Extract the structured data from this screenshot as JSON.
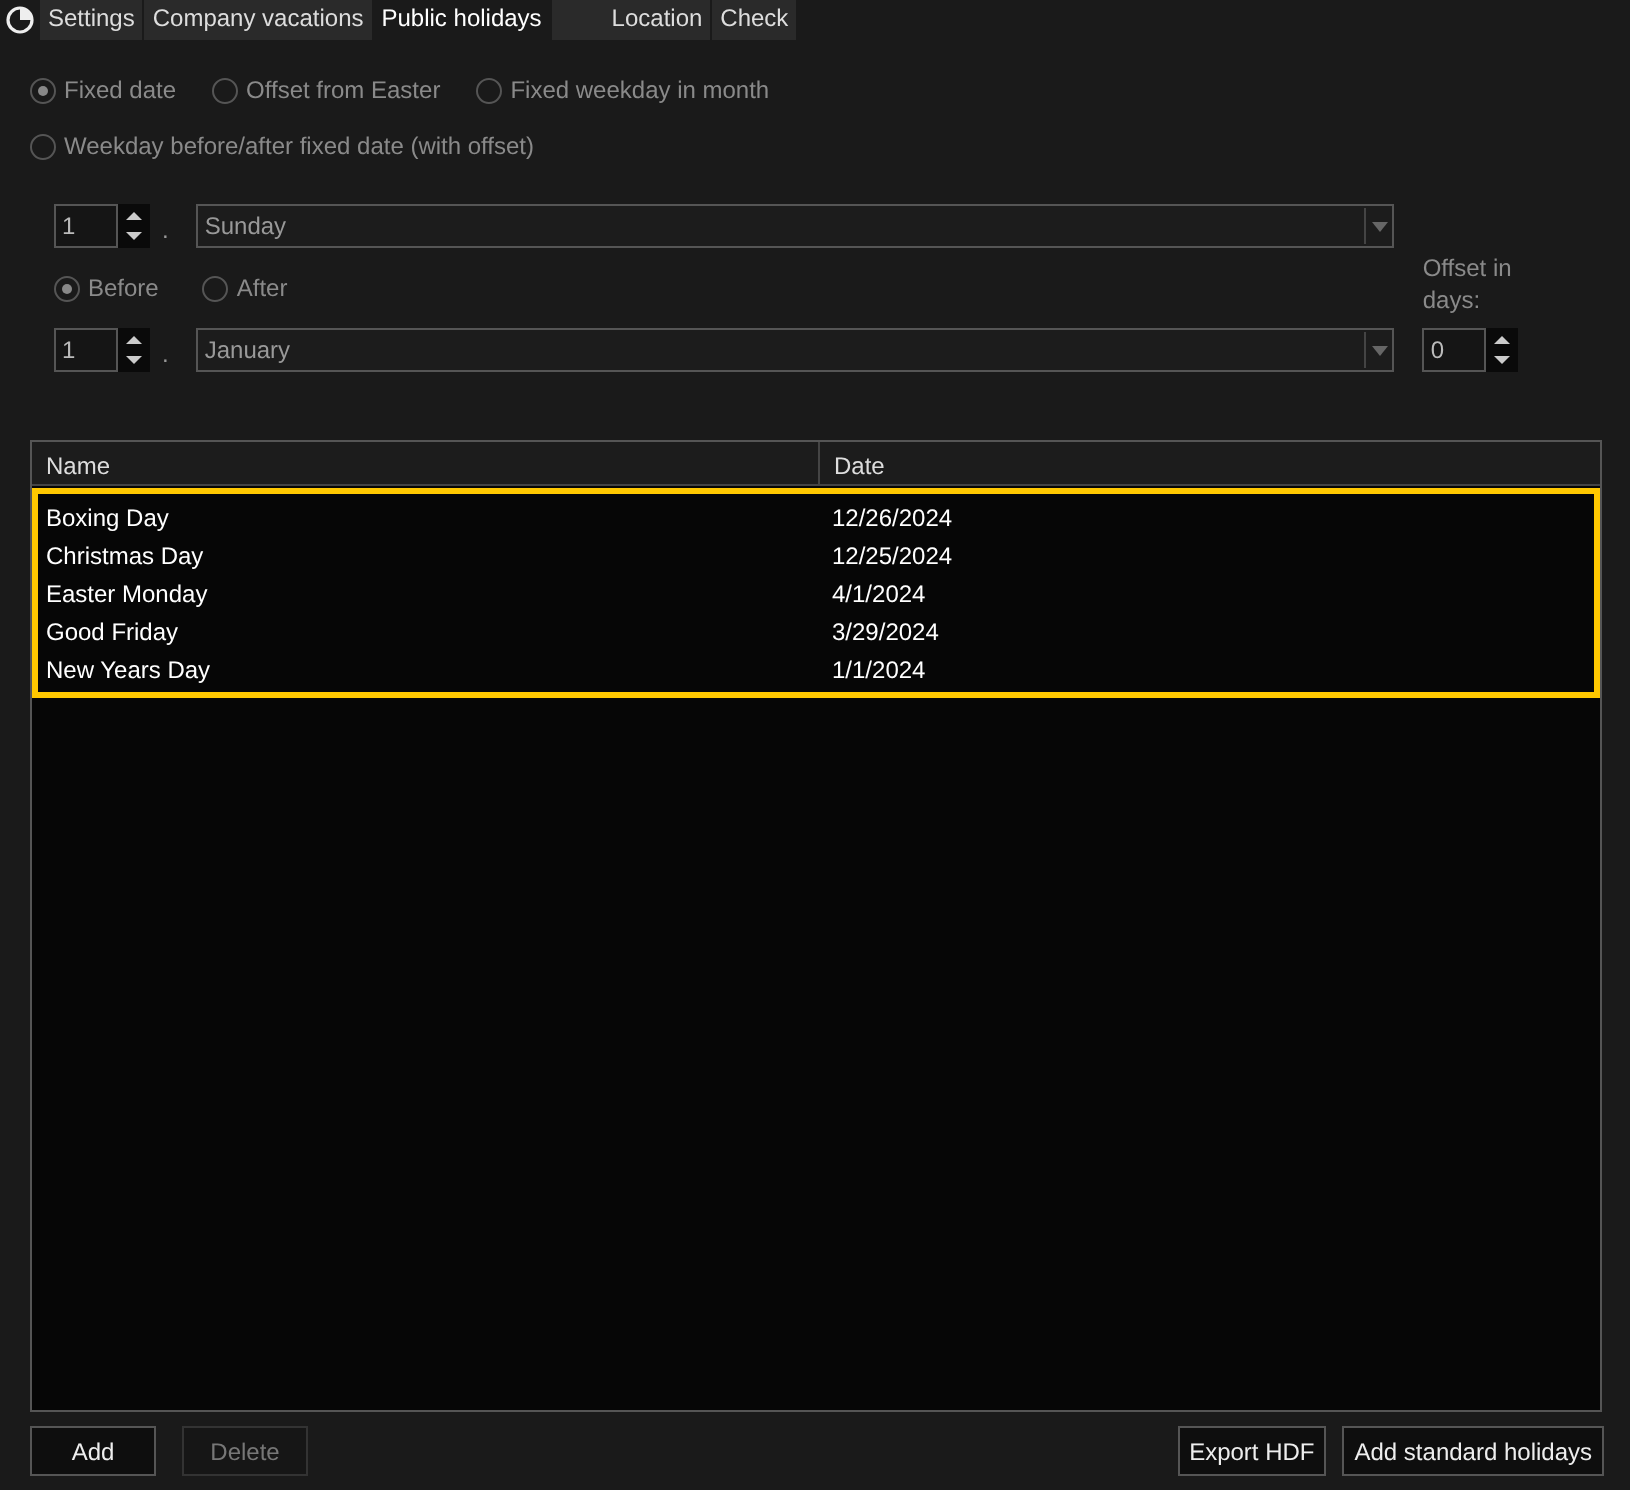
{
  "tabs": [
    {
      "label": "Settings",
      "selected": false
    },
    {
      "label": "Company vacations",
      "selected": false
    },
    {
      "label": "Public holidays",
      "selected": true
    },
    {
      "label": "Location",
      "selected": false
    },
    {
      "label": "Check",
      "selected": false
    }
  ],
  "rule_types": [
    {
      "label": "Fixed date",
      "selected": true,
      "disabled": true
    },
    {
      "label": "Offset from Easter",
      "selected": false,
      "disabled": true
    },
    {
      "label": "Fixed weekday in month",
      "selected": false,
      "disabled": true
    },
    {
      "label": "Weekday before/after fixed date (with offset)",
      "selected": false,
      "disabled": true
    }
  ],
  "weekday": {
    "number": "1",
    "separator": ".",
    "value": "Sunday"
  },
  "direction": [
    {
      "label": "Before",
      "selected": true,
      "disabled": true
    },
    {
      "label": "After",
      "selected": false,
      "disabled": true
    }
  ],
  "month": {
    "number": "1",
    "separator": ".",
    "value": "January"
  },
  "offset": {
    "label": "Offset in days:",
    "value": "0"
  },
  "table": {
    "columns": [
      "Name",
      "Date"
    ],
    "rows_highlighted": true,
    "rows": [
      [
        "Boxing Day",
        "12/26/2024"
      ],
      [
        "Christmas Day",
        "12/25/2024"
      ],
      [
        "Easter Monday",
        "4/1/2024"
      ],
      [
        "Good Friday",
        "3/29/2024"
      ],
      [
        "New Years Day",
        "1/1/2024"
      ]
    ]
  },
  "buttons_left": [
    {
      "label": "Add",
      "disabled": false
    },
    {
      "label": "Delete",
      "disabled": true
    }
  ],
  "buttons_right": [
    {
      "label": "Export HDF",
      "disabled": false
    },
    {
      "label": "Add standard holidays",
      "disabled": false
    }
  ]
}
